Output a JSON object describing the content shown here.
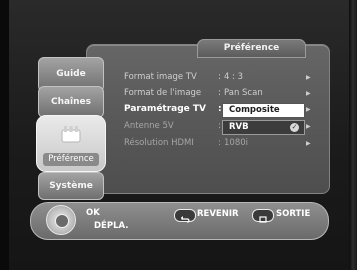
{
  "menu": {
    "title": "Préférence",
    "tabs": [
      "Guide",
      "Chaînes",
      "Préférence",
      "Système"
    ]
  },
  "settings": [
    {
      "label": "Format image TV",
      "value": "4 : 3"
    },
    {
      "label": "Format de l'image",
      "value": "Pan Scan"
    },
    {
      "label": "Paramétrage TV",
      "value": ""
    },
    {
      "label": "Antenne 5V",
      "value": ""
    },
    {
      "label": "Résolution HDMI",
      "value": "1080i"
    }
  ],
  "options": {
    "selected": "Composite",
    "alternate": "RVB"
  },
  "hints": {
    "ok": "OK",
    "move": "DÉPLA.",
    "back": "REVENIR",
    "exit": "SORTIE"
  }
}
